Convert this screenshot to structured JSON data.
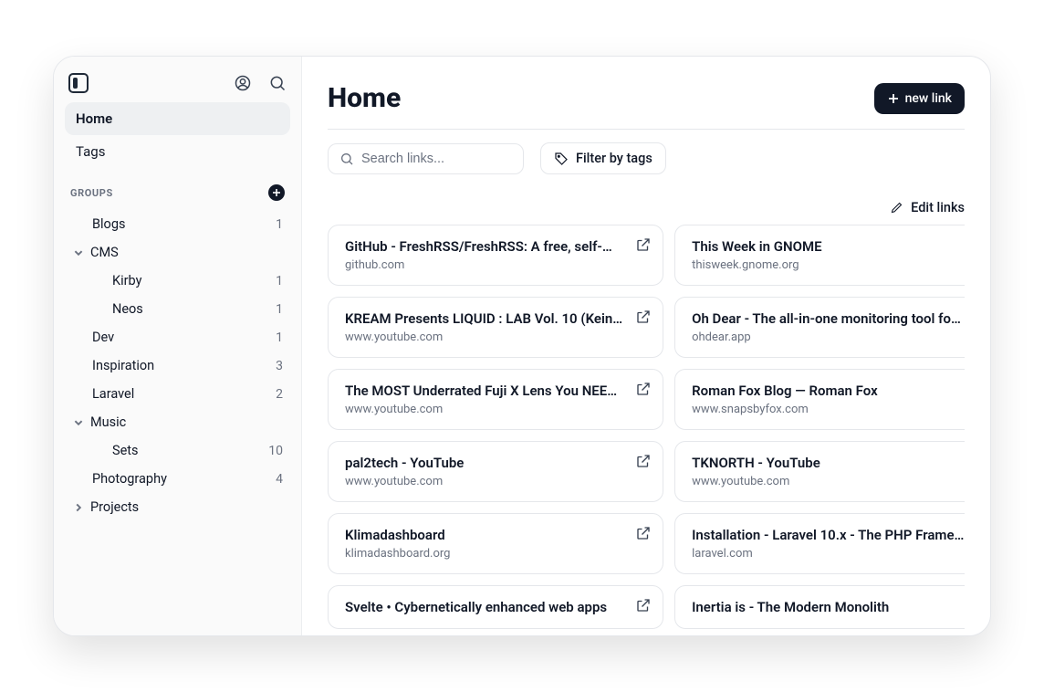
{
  "sidebar": {
    "nav": {
      "home": "Home",
      "tags": "Tags"
    },
    "groups_label": "GROUPS",
    "groups": [
      {
        "name": "Blogs",
        "count": "1",
        "indent": 1,
        "chevron": null
      },
      {
        "name": "CMS",
        "count": "",
        "indent": 0,
        "chevron": "down"
      },
      {
        "name": "Kirby",
        "count": "1",
        "indent": 2,
        "chevron": null
      },
      {
        "name": "Neos",
        "count": "1",
        "indent": 2,
        "chevron": null
      },
      {
        "name": "Dev",
        "count": "1",
        "indent": 1,
        "chevron": null
      },
      {
        "name": "Inspiration",
        "count": "3",
        "indent": 1,
        "chevron": null
      },
      {
        "name": "Laravel",
        "count": "2",
        "indent": 1,
        "chevron": null
      },
      {
        "name": "Music",
        "count": "",
        "indent": 0,
        "chevron": "down"
      },
      {
        "name": "Sets",
        "count": "10",
        "indent": 2,
        "chevron": null
      },
      {
        "name": "Photography",
        "count": "4",
        "indent": 1,
        "chevron": null
      },
      {
        "name": "Projects",
        "count": "",
        "indent": 0,
        "chevron": "right"
      }
    ]
  },
  "header": {
    "title": "Home",
    "new_link": "new link"
  },
  "controls": {
    "search_placeholder": "Search links...",
    "filter_label": "Filter by tags",
    "edit_links": "Edit links"
  },
  "links": [
    {
      "title": "GitHub - FreshRSS/FreshRSS: A free, self-…",
      "domain": "github.com"
    },
    {
      "title": "This Week in GNOME",
      "domain": "thisweek.gnome.org"
    },
    {
      "title": "KREAM Presents LIQUID : LAB Vol. 10 (Kein…",
      "domain": "www.youtube.com"
    },
    {
      "title": "Oh Dear - The all-in-one monitoring tool fo…",
      "domain": "ohdear.app"
    },
    {
      "title": "The MOST Underrated Fuji X Lens You NEE…",
      "domain": "www.youtube.com"
    },
    {
      "title": "Roman Fox Blog — Roman Fox",
      "domain": "www.snapsbyfox.com"
    },
    {
      "title": "pal2tech - YouTube",
      "domain": "www.youtube.com"
    },
    {
      "title": "TKNORTH - YouTube",
      "domain": "www.youtube.com"
    },
    {
      "title": "Klimadashboard",
      "domain": "klimadashboard.org"
    },
    {
      "title": "Installation - Laravel 10.x - The PHP Frame…",
      "domain": "laravel.com"
    },
    {
      "title": "Svelte • Cybernetically enhanced web apps",
      "domain": ""
    },
    {
      "title": "Inertia is - The Modern Monolith",
      "domain": ""
    }
  ]
}
